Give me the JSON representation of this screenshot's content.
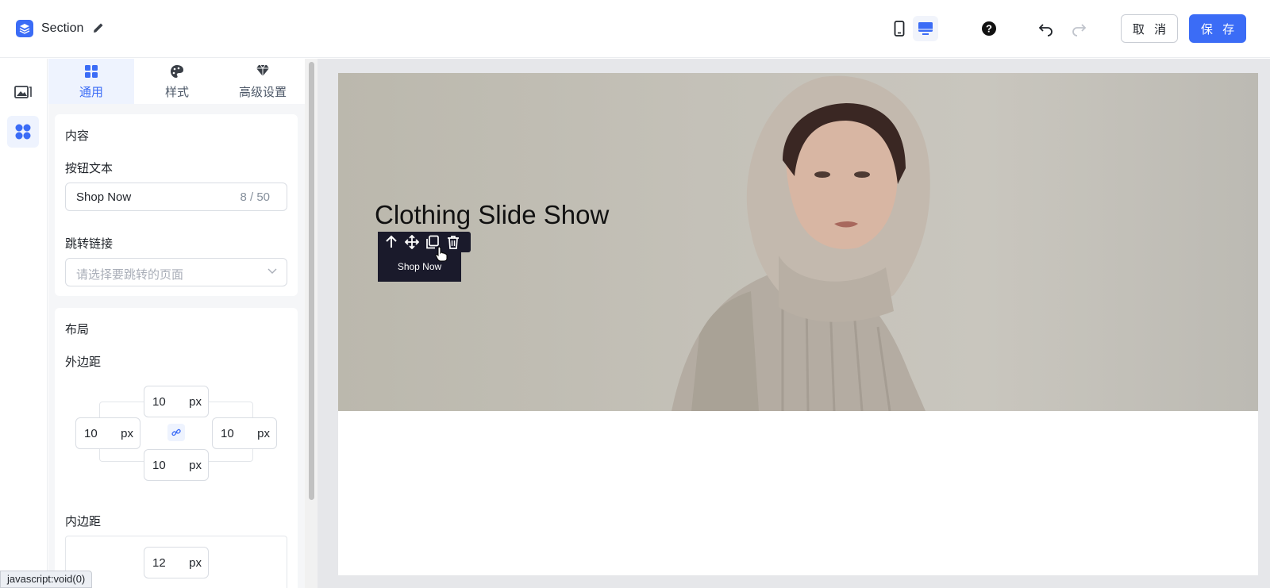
{
  "header": {
    "title": "Section",
    "cancel_label": "取 消",
    "save_label": "保 存",
    "colors": {
      "accent": "#3b6cf6"
    }
  },
  "panel": {
    "tabs": [
      {
        "label": "通用",
        "icon": "grid-icon",
        "active": true
      },
      {
        "label": "样式",
        "icon": "palette-icon",
        "active": false
      },
      {
        "label": "高级设置",
        "icon": "diamond-icon",
        "active": false
      }
    ],
    "content": {
      "title": "内容",
      "button_text_label": "按钮文本",
      "button_text_value": "Shop Now",
      "button_text_count": "8 / 50",
      "link_label": "跳转链接",
      "link_placeholder": "请选择要跳转的页面"
    },
    "layout": {
      "title": "布局",
      "margin_label": "外边距",
      "margin": {
        "top": "10",
        "left": "10",
        "right": "10",
        "bottom": "10",
        "unit": "px"
      },
      "padding_label": "内边距",
      "padding": {
        "top": "12",
        "unit": "px"
      }
    }
  },
  "canvas": {
    "hero_title": "Clothing Slide Show",
    "button_label": "Shop Now",
    "toolbar_tools": [
      "arrow-up-icon",
      "move-icon",
      "copy-icon",
      "trash-icon"
    ]
  },
  "status_bar": {
    "text": "javascript:void(0)"
  }
}
